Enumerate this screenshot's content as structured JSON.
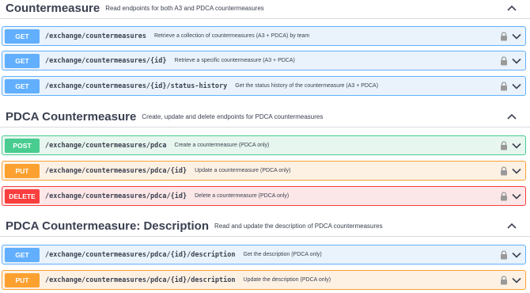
{
  "sections": [
    {
      "title": "Countermeasure",
      "description": "Read endpoints for both A3 and PDCA countermeasures",
      "operations": [
        {
          "method": "GET",
          "path": "/exchange/countermeasures",
          "summary": "Retrieve a collection of countermeasures (A3 + PDCA) by team"
        },
        {
          "method": "GET",
          "path": "/exchange/countermeasures/{id}",
          "summary": "Retrieve a specific countermeasure (A3 + PDCA)"
        },
        {
          "method": "GET",
          "path": "/exchange/countermeasures/{id}/status-history",
          "summary": "Get the status history of the countermeasure (A3 + PDCA)"
        }
      ]
    },
    {
      "title": "PDCA Countermeasure",
      "description": "Create, update and delete endpoints for PDCA countermeasures",
      "operations": [
        {
          "method": "POST",
          "path": "/exchange/countermeasures/pdca",
          "summary": "Create a countermeasure (PDCA only)"
        },
        {
          "method": "PUT",
          "path": "/exchange/countermeasures/pdca/{id}",
          "summary": "Update a countermeasure (PDCA only)"
        },
        {
          "method": "DELETE",
          "path": "/exchange/countermeasures/pdca/{id}",
          "summary": "Delete a countermeasure (PDCA only)"
        }
      ]
    },
    {
      "title": "PDCA Countermeasure: Description",
      "description": "Read and update the description of PDCA countermeasures",
      "operations": [
        {
          "method": "GET",
          "path": "/exchange/countermeasures/pdca/{id}/description",
          "summary": "Get the description (PDCA only)"
        },
        {
          "method": "PUT",
          "path": "/exchange/countermeasures/pdca/{id}/description",
          "summary": "Update the description (PDCA only)"
        }
      ]
    }
  ],
  "icons": {
    "section_toggle": "chevron-up-icon",
    "lock": "lock-icon",
    "expand": "chevron-down-icon"
  },
  "colors": {
    "get": "#61affe",
    "post": "#49cc90",
    "put": "#fca130",
    "delete": "#f93e3e"
  }
}
